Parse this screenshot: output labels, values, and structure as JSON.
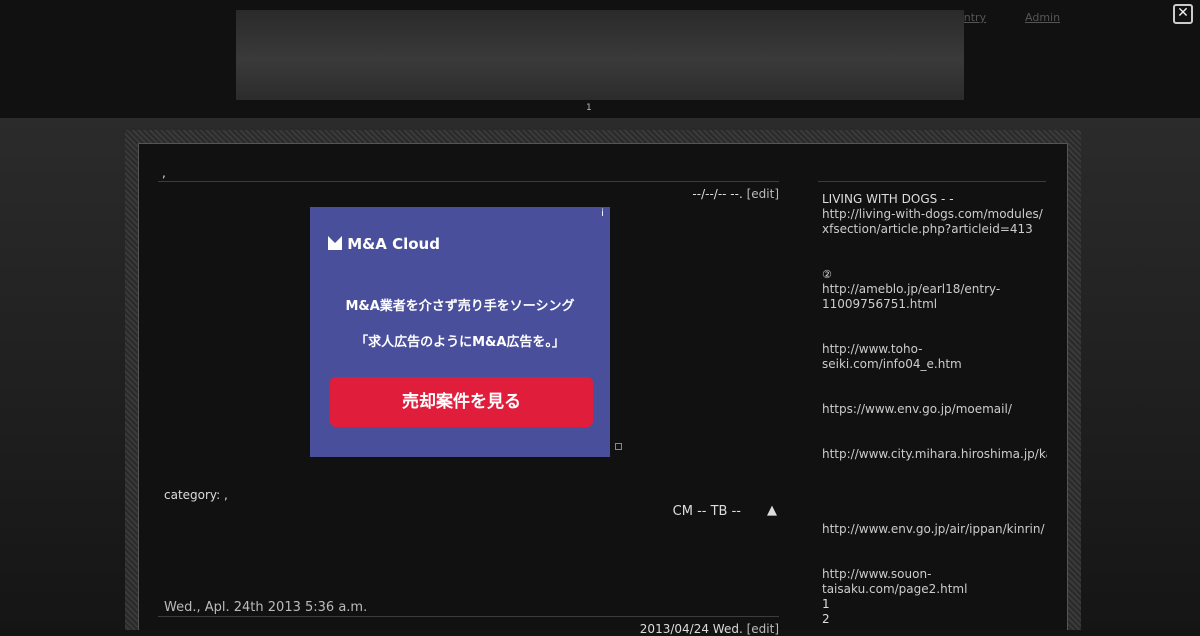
{
  "header": {
    "nav": [
      "entry",
      "Admin"
    ],
    "page_number": "1",
    "close_icon": "close-icon"
  },
  "article1": {
    "title": ",",
    "meta": "--/--/-- --.",
    "edit": "[edit]",
    "category": "category: ,",
    "footer_links": "CM -- TB --",
    "top_arrow": "▲"
  },
  "ad": {
    "brand": "M&A Cloud",
    "line1": "M&A業者を介さず売り手をソーシング",
    "line2": "「求人広告のようにM&A広告を。」",
    "cta": "売却案件を見る",
    "info": "i",
    "background": "#4a4f9c",
    "cta_color": "#e01e3c"
  },
  "article2": {
    "title": "Wed., Apl. 24th 2013 5:36 a.m.",
    "meta": "2013/04/24 Wed.",
    "edit": "[edit]"
  },
  "sidebar": {
    "heading": "LIVING WITH DOGS - -",
    "link1": "http://living-with-dogs.com/modules/xfsection/article.php?articleid=413",
    "circle_two": "②",
    "link2": "http://ameblo.jp/earl18/entry-11009756751.html",
    "link3": "http://www.toho-seiki.com/info04_e.htm",
    "link4": "https://www.env.go.jp/moemail/",
    "link5": "http://www.city.mihara.hiroshima.jp/kankyo/",
    "link6": "http://www.env.go.jp/air/ippan/kinrin/",
    "link7": "http://www.souon-taisaku.com/page2.html",
    "n1": "1",
    "n2": "2"
  }
}
